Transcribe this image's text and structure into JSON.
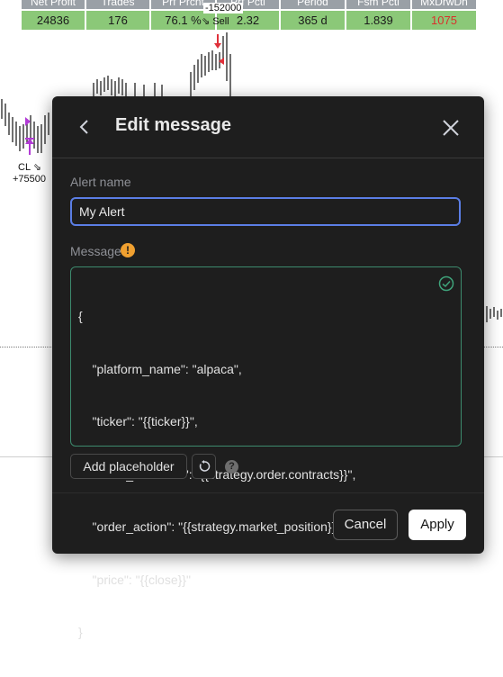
{
  "stats": {
    "headers": [
      "Net Profit",
      "Trades",
      "Prf Prcnt",
      "Prf Pctl",
      "Period",
      "Fsm Pctl",
      "MxDrwDn"
    ],
    "values": [
      "24836",
      "176",
      "76.1 %",
      "2.32",
      "365 d",
      "1.839",
      "1075"
    ]
  },
  "chart": {
    "top_label": "-152000",
    "sell_label": "Sell",
    "cl_label": "CL",
    "cl_value": "+75500",
    "colors": {
      "candle": "#111111",
      "marker_buy": "#b23ad6",
      "marker_sell": "#e0303a",
      "value_bg": "#8bc878",
      "negative": "#d9312c"
    }
  },
  "dialog": {
    "title": "Edit message",
    "alert_name_label": "Alert name",
    "alert_name_value": "My Alert",
    "message_label": "Message",
    "message_lines": [
      "{",
      "    \"platform_name\": \"alpaca\",",
      "    \"ticker\": \"{{ticker}}\",",
      "    \"order_contracts\": \"{{strategy.order.contracts}}\",",
      "    \"order_action\": \"{{strategy.market_position}}\",",
      "    \"price\": \"{{close}}\"",
      "}"
    ],
    "add_placeholder_label": "Add placeholder",
    "cancel_label": "Cancel",
    "apply_label": "Apply",
    "icons": [
      "back-arrow-icon",
      "close-icon",
      "warning-icon",
      "check-circle-icon",
      "reset-icon",
      "help-icon"
    ],
    "colors": {
      "bg": "#1e1e1e",
      "input_focus": "#5b7ee5",
      "valid_border": "#3d8a6d",
      "warning": "#f0a030"
    }
  }
}
